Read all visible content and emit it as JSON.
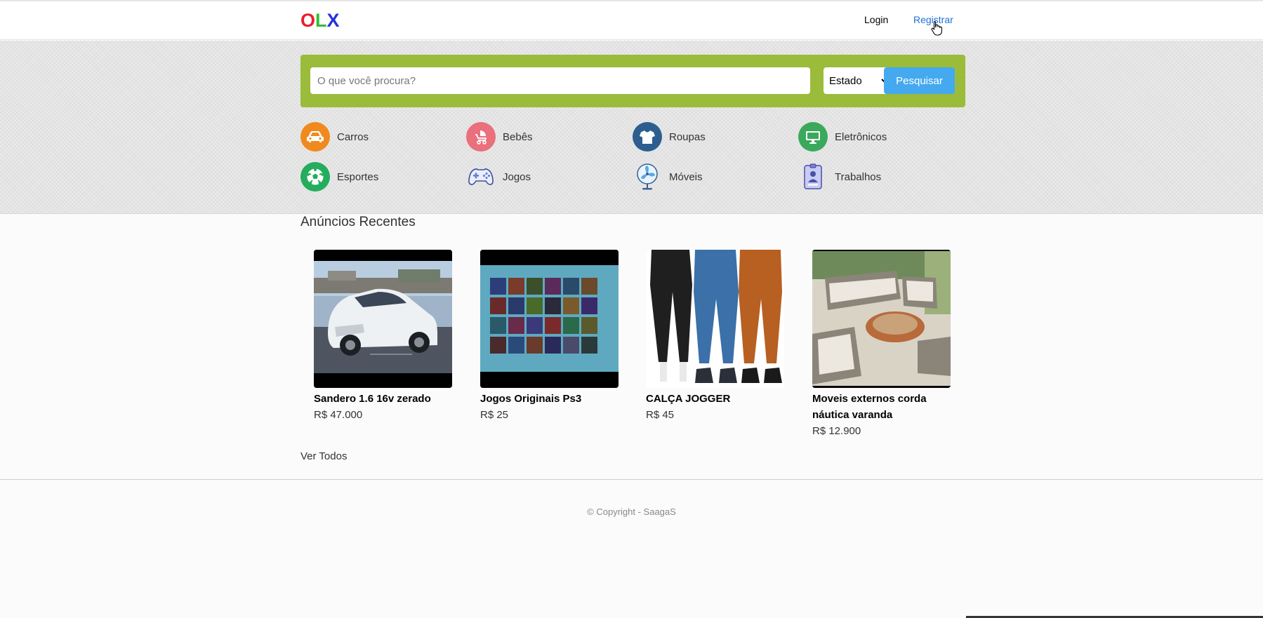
{
  "header": {
    "logo_letters": [
      "O",
      "L",
      "X"
    ],
    "logo_colors": [
      "#e8202a",
      "#2fbe34",
      "#2533d9"
    ],
    "login_label": "Login",
    "register_label": "Registrar"
  },
  "search": {
    "placeholder": "O que você procura?",
    "state_selected": "Estado",
    "button_label": "Pesquisar",
    "box_color": "#9bbb3a",
    "button_color": "#45a9ef"
  },
  "categories": [
    {
      "label": "Carros",
      "icon": "car-icon",
      "color": "#f08a1f"
    },
    {
      "label": "Bebês",
      "icon": "stroller-icon",
      "color": "#e9707c"
    },
    {
      "label": "Roupas",
      "icon": "shirt-icon",
      "color": "#2d5e8f"
    },
    {
      "label": "Eletrônicos",
      "icon": "monitor-icon",
      "color": "#3aa95b"
    },
    {
      "label": "Esportes",
      "icon": "soccer-ball-icon",
      "color": "#23ad5c"
    },
    {
      "label": "Jogos",
      "icon": "gamepad-icon",
      "color": "#6a7fd9"
    },
    {
      "label": "Móveis",
      "icon": "fan-icon",
      "color": "#4a90d9"
    },
    {
      "label": "Trabalhos",
      "icon": "id-badge-icon",
      "color": "#7c7fd6"
    }
  ],
  "recent": {
    "title": "Anúncios Recentes",
    "items": [
      {
        "title": "Sandero 1.6 16v zerado",
        "price": "R$ 47.000"
      },
      {
        "title": "Jogos Originais Ps3",
        "price": "R$ 25"
      },
      {
        "title": "CALÇA JOGGER",
        "price": "R$ 45"
      },
      {
        "title": "Moveis externos corda náutica varanda",
        "price": "R$ 12.900"
      }
    ],
    "see_all_label": "Ver Todos"
  },
  "footer": {
    "copyright": "© Copyright - SaagaS"
  }
}
